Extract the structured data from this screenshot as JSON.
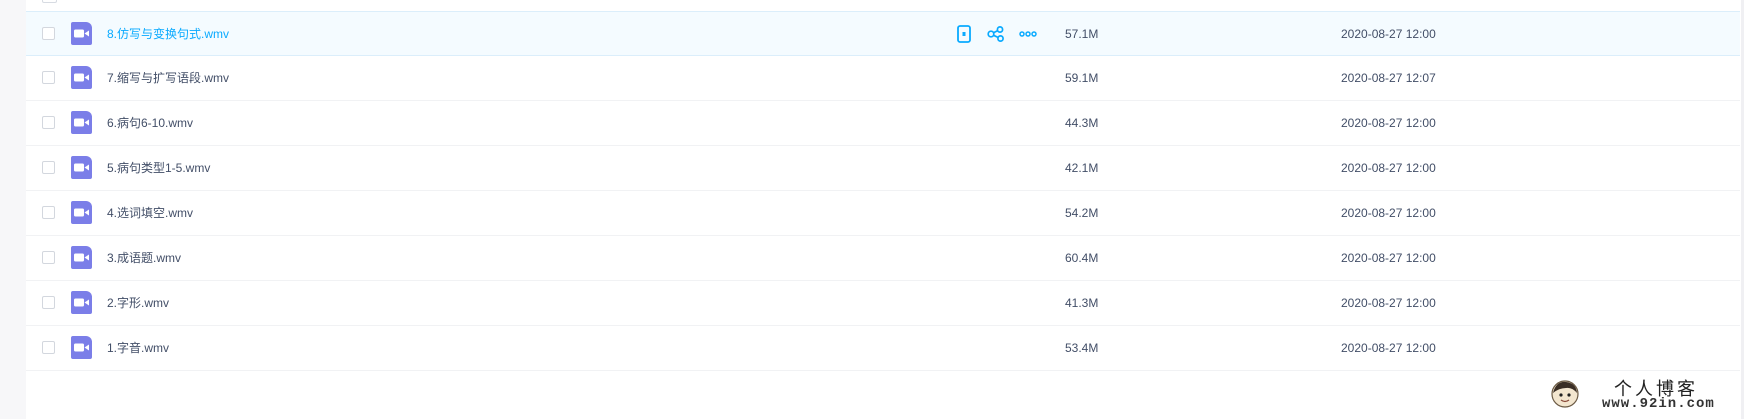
{
  "files": [
    {
      "name": "8.仿写与变换句式.wmv",
      "size": "57.1M",
      "date": "2020-08-27 12:00"
    },
    {
      "name": "7.缩写与扩写语段.wmv",
      "size": "59.1M",
      "date": "2020-08-27 12:07"
    },
    {
      "name": "6.病句6-10.wmv",
      "size": "44.3M",
      "date": "2020-08-27 12:00"
    },
    {
      "name": "5.病句类型1-5.wmv",
      "size": "42.1M",
      "date": "2020-08-27 12:00"
    },
    {
      "name": "4.选词填空.wmv",
      "size": "54.2M",
      "date": "2020-08-27 12:00"
    },
    {
      "name": "3.成语题.wmv",
      "size": "60.4M",
      "date": "2020-08-27 12:00"
    },
    {
      "name": "2.字形.wmv",
      "size": "41.3M",
      "date": "2020-08-27 12:00"
    },
    {
      "name": "1.字音.wmv",
      "size": "53.4M",
      "date": "2020-08-27 12:00"
    }
  ],
  "hover_actions": [
    {
      "icon": "phone-icon"
    },
    {
      "icon": "share-icon"
    },
    {
      "icon": "more-icon"
    }
  ],
  "watermark": {
    "title": "个人博客",
    "url": "www.92in.com"
  },
  "colors": {
    "accent": "#09aaff",
    "video_icon": "#7b7ee8",
    "text": "#424e67",
    "hover_row": "#f4fbff"
  }
}
